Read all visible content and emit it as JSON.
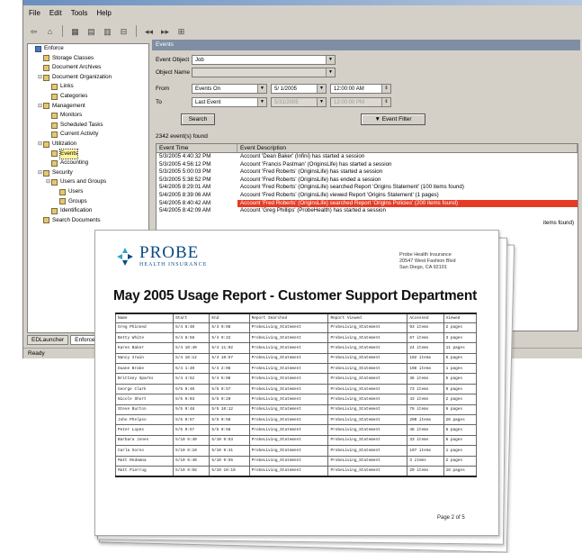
{
  "app": {
    "menu": [
      "File",
      "Edit",
      "Tools",
      "Help"
    ],
    "toolbar_glyphs": [
      "⇦",
      "⌂",
      "▦",
      "▤",
      "▥",
      "⊟",
      "◂◂",
      "▸▸",
      "⊞"
    ],
    "tree": [
      {
        "label": "Enforce",
        "depth": 0,
        "expander": "",
        "root": true
      },
      {
        "label": "Storage Classes",
        "depth": 1,
        "expander": ""
      },
      {
        "label": "Document Archives",
        "depth": 1,
        "expander": ""
      },
      {
        "label": "Document Organization",
        "depth": 1,
        "expander": "⊟"
      },
      {
        "label": "Links",
        "depth": 2,
        "expander": ""
      },
      {
        "label": "Categories",
        "depth": 2,
        "expander": ""
      },
      {
        "label": "Management",
        "depth": 1,
        "expander": "⊟"
      },
      {
        "label": "Monitors",
        "depth": 2,
        "expander": ""
      },
      {
        "label": "Scheduled Tasks",
        "depth": 2,
        "expander": ""
      },
      {
        "label": "Current Activity",
        "depth": 2,
        "expander": ""
      },
      {
        "label": "Utilization",
        "depth": 1,
        "expander": "⊟"
      },
      {
        "label": "Events",
        "depth": 2,
        "expander": "",
        "selected": true
      },
      {
        "label": "Accounting",
        "depth": 2,
        "expander": ""
      },
      {
        "label": "Security",
        "depth": 1,
        "expander": "⊟"
      },
      {
        "label": "Users and Groups",
        "depth": 2,
        "expander": "⊟"
      },
      {
        "label": "Users",
        "depth": 3,
        "expander": ""
      },
      {
        "label": "Groups",
        "depth": 3,
        "expander": ""
      },
      {
        "label": "Identification",
        "depth": 2,
        "expander": ""
      },
      {
        "label": "Search Documents",
        "depth": 1,
        "expander": ""
      }
    ],
    "bottom_tabs": [
      "EDLauncher",
      "Enforce"
    ],
    "status": "Ready",
    "events": {
      "header": "Events",
      "event_object_label": "Event Object",
      "event_object_value": "Job",
      "object_name_label": "Object Name",
      "object_name_value": "",
      "from_label": "From",
      "from_mode": "Events On",
      "from_date": "5/ 1/2005",
      "from_time": "12:00:00 AM",
      "to_label": "To",
      "to_mode": "Last Event",
      "to_date": "5/31/2005",
      "to_time": "12:00:00 PM",
      "search_button": "Search",
      "event_filter_button": "Event Filter",
      "found": "2342 event(s) found",
      "col_time": "Event Time",
      "col_desc": "Event Description",
      "rows": [
        {
          "time": "5/3/2005 4:40:32 PM",
          "desc": "Account 'Dean Baker' (Infini) has started a session"
        },
        {
          "time": "5/3/2005 4:56:12 PM",
          "desc": "Account 'Francis Pastman' (OriginsLife) has started a session"
        },
        {
          "time": "5/3/2005 5:00:03 PM",
          "desc": "Account 'Fred Roberts' (OriginsLife) has started a session"
        },
        {
          "time": "5/3/2005 5:38:52 PM",
          "desc": "Account 'Fred Roberts' (OriginsLife) has ended a session"
        },
        {
          "time": "5/4/2005 8:29:01 AM",
          "desc": "Account 'Fred Roberts' (OriginsLife) searched Report 'Origins Statement' (100 items found)"
        },
        {
          "time": "5/4/2005 8:39:06 AM",
          "desc": "Account 'Fred Roberts' (OriginsLife) viewed Report 'Origins Statement' (1 pages)"
        },
        {
          "time": "5/4/2005 8:40:42 AM",
          "desc": "Account 'Fred Roberts' (OriginsLife) searched Report 'Origins Policies' (200 items found)",
          "selected": true
        },
        {
          "time": "5/4/2005 8:42:09 AM",
          "desc": "Account 'Greg Phillips' (ProbeHealth) has started a session"
        }
      ],
      "trail": "items found)"
    }
  },
  "report": {
    "company_name": "PROBE",
    "company_tagline": "HEALTH INSURANCE",
    "address": [
      "Probe Health Insurance",
      "20547 West Fashion Blvd",
      "San Diego, CA 92101"
    ],
    "title": "May 2005 Usage Report - Customer Support Department",
    "columns": [
      "Name",
      "Start",
      "End",
      "Report Searched",
      "Report Viewed",
      "Accessed",
      "Viewed"
    ],
    "rows": [
      [
        "Greg Phinned",
        "5/4 8:40",
        "5/4 9:08",
        "ProbeLiving_Statement",
        "ProbeLiving_Statement",
        "93 items",
        "2 pages"
      ],
      [
        "Betty White",
        "5/4 8:58",
        "5/4 9:22",
        "ProbeLiving_Statement",
        "ProbeLiving_Statement",
        "67 items",
        "3 pages"
      ],
      [
        "Karen Baker",
        "5/4 10:40",
        "5/4 11:02",
        "ProbeLiving_Statement",
        "ProbeLiving_Statement",
        "24 items",
        "11 pages"
      ],
      [
        "Nancy Irwin",
        "5/4 10:12",
        "5/4 10:57",
        "ProbeLiving_Statement",
        "ProbeLiving_Statement",
        "102 items",
        "6 pages"
      ],
      [
        "Duane Brake",
        "5/4 1:40",
        "5/4 2:06",
        "ProbeLiving_Statement",
        "ProbeLiving_Statement",
        "108 items",
        "1 pages"
      ],
      [
        "Brittany Sparks",
        "5/4 4:52",
        "5/4 5:08",
        "ProbeLiving_Statement",
        "ProbeLiving_Statement",
        "38 items",
        "5 pages"
      ],
      [
        "George Clark",
        "5/5 9:40",
        "5/5 9:57",
        "ProbeLiving_Statement",
        "ProbeLiving_Statement",
        "73 items",
        "9 pages"
      ],
      [
        "Nicole Short",
        "5/5 9:03",
        "5/5 9:20",
        "ProbeLiving_Statement",
        "ProbeLiving_Statement",
        "43 items",
        "2 pages"
      ],
      [
        "Steve Burton",
        "5/5 9:48",
        "5/5 10:12",
        "ProbeLiving_Statement",
        "ProbeLiving_Statement",
        "78 items",
        "6 pages"
      ],
      [
        "John Phelpso",
        "5/5 9:57",
        "5/5 9:58",
        "ProbeLiving_Statement",
        "ProbeLiving_Statement",
        "200 items",
        "20 pages"
      ],
      [
        "Peter Lopes",
        "5/5 9:57",
        "5/5 9:58",
        "ProbeLiving_Statement",
        "ProbeLiving_Statement",
        "48 items",
        "8 pages"
      ],
      [
        "Barbara Jones",
        "5/10 9:40",
        "5/10 9:53",
        "ProbeLiving_Statement",
        "ProbeLiving_Statement",
        "33 items",
        "6 pages"
      ],
      [
        "Carla Sorno",
        "5/10 9:10",
        "5/10 9:41",
        "ProbeLiving_Statement",
        "ProbeLiving_Statement",
        "107 items",
        "1 pages"
      ],
      [
        "Matt Redamna",
        "5/10 9:40",
        "5/10 9:55",
        "ProbeLiving_Statement",
        "ProbeLiving_Statement",
        "3 items",
        "2 pages"
      ],
      [
        "Matt Pierrug",
        "5/10 9:58",
        "5/10 10:10",
        "ProbeLiving_Statement",
        "ProbeLiving_Statement",
        "20 items",
        "16 pages"
      ]
    ],
    "page_number": "Page 2 of 5"
  },
  "colors": {
    "accent": "#0f4a82",
    "selection": "#e63b23",
    "panel_header": "#7f8ea3"
  }
}
